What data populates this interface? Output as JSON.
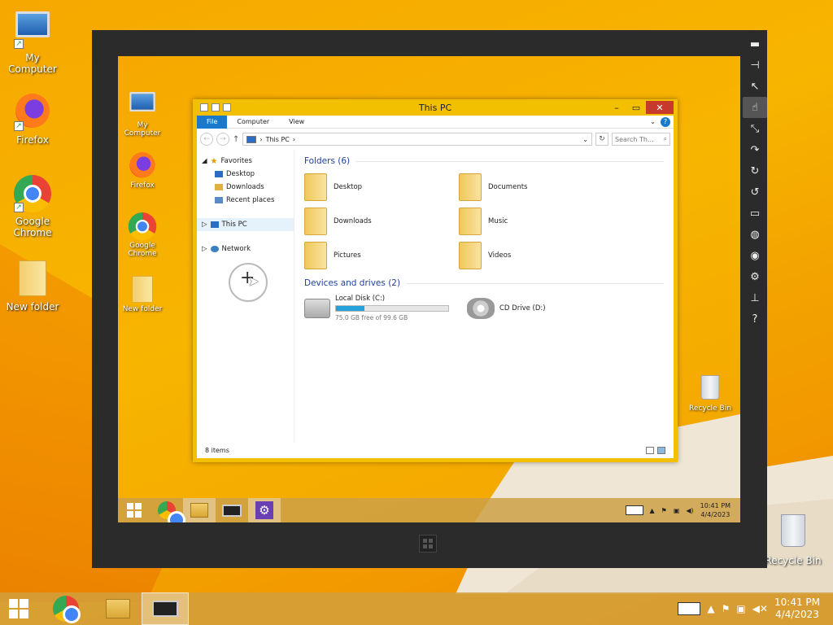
{
  "desktop": {
    "icons": [
      {
        "label": "My Computer"
      },
      {
        "label": "Firefox"
      },
      {
        "label": "Google Chrome"
      },
      {
        "label": "New folder"
      },
      {
        "label": "Recycle Bin"
      }
    ]
  },
  "remote": {
    "desktop_icons": [
      {
        "label": "My Computer"
      },
      {
        "label": "Firefox"
      },
      {
        "label": "Google Chrome"
      },
      {
        "label": "New folder"
      },
      {
        "label": "Recycle Bin"
      }
    ],
    "toolbar": [
      "minimize-icon",
      "pin-icon",
      "pointer-icon",
      "hand-icon",
      "resize-icon",
      "rotate-icon",
      "refresh-cw-icon",
      "refresh-ccw-icon",
      "monitor-icon",
      "globe-icon",
      "camera-icon",
      "settings-icon",
      "usb-icon",
      "help-icon"
    ],
    "explorer": {
      "title": "This PC",
      "ribbon_tabs": [
        "File",
        "Computer",
        "View"
      ],
      "address": "This PC",
      "search_placeholder": "Search Th...",
      "nav": {
        "favorites": "Favorites",
        "desktop": "Desktop",
        "downloads": "Downloads",
        "recent": "Recent places",
        "this_pc": "This PC",
        "network": "Network"
      },
      "folders_title": "Folders (6)",
      "folders": [
        "Desktop",
        "Documents",
        "Downloads",
        "Music",
        "Pictures",
        "Videos"
      ],
      "devices_title": "Devices and drives (2)",
      "local_disk": {
        "name": "Local Disk (C:)",
        "free": "75.0 GB free of 99.6 GB",
        "used_fraction": 0.25
      },
      "cd_drive": "CD Drive (D:)",
      "status": "8 items"
    },
    "taskbar": {
      "time": "10:41 PM",
      "date": "4/4/2023"
    }
  },
  "taskbar": {
    "time": "10:41 PM",
    "date": "4/4/2023"
  },
  "colors": {
    "accent": "#f2c000",
    "file_tab": "#1979ca",
    "close": "#c7392b"
  }
}
